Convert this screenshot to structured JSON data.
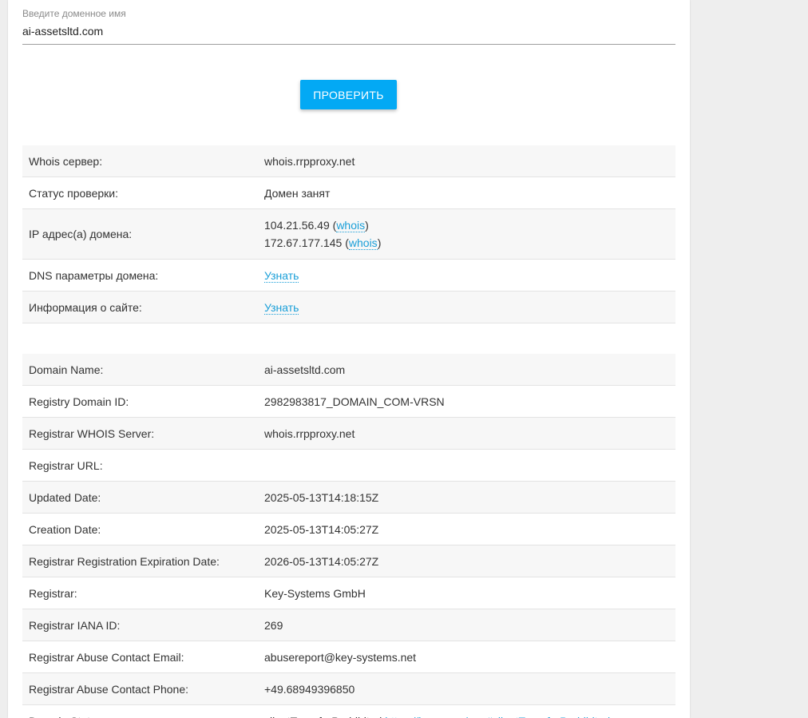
{
  "form": {
    "label": "Введите доменное имя",
    "domain_value": "ai-assetsltd.com",
    "check_button": "ПРОВЕРИТЬ"
  },
  "summary": {
    "whois_server_label": "Whois сервер:",
    "whois_server_value": "whois.rrpproxy.net",
    "status_label": "Статус проверки:",
    "status_value": "Домен занят",
    "ip_label": "IP адрес(а) домена:",
    "ips": [
      {
        "ip": "104.21.56.49",
        "open": " (",
        "link": "whois",
        "close": ")"
      },
      {
        "ip": "172.67.177.145",
        "open": " (",
        "link": "whois",
        "close": ")"
      }
    ],
    "dns_label": "DNS параметры домена:",
    "dns_link": "Узнать",
    "site_label": "Информация о сайте:",
    "site_link": "Узнать"
  },
  "whois_rows": [
    {
      "key": "Domain Name:",
      "value": "ai-assetsltd.com"
    },
    {
      "key": "Registry Domain ID:",
      "value": "2982983817_DOMAIN_COM-VRSN"
    },
    {
      "key": "Registrar WHOIS Server:",
      "value": "whois.rrpproxy.net"
    },
    {
      "key": "Registrar URL:",
      "value": ""
    },
    {
      "key": "Updated Date:",
      "value": "2025-05-13T14:18:15Z"
    },
    {
      "key": "Creation Date:",
      "value": "2025-05-13T14:05:27Z"
    },
    {
      "key": "Registrar Registration Expiration Date:",
      "value": "2026-05-13T14:05:27Z"
    },
    {
      "key": "Registrar:",
      "value": "Key-Systems GmbH"
    },
    {
      "key": "Registrar IANA ID:",
      "value": "269"
    },
    {
      "key": "Registrar Abuse Contact Email:",
      "value": "abusereport@key-systems.net"
    },
    {
      "key": "Registrar Abuse Contact Phone:",
      "value": "+49.68949396850"
    }
  ],
  "status_row": {
    "key": "Domain Status:",
    "value": "clientTransferProhibited",
    "link": "https://icann.org/epp#clientTransferProhibited"
  },
  "colors": {
    "accent": "#03a9f4",
    "link": "#1a9fd8",
    "background": "#eeeeee",
    "stripe": "#f7f7f7"
  }
}
